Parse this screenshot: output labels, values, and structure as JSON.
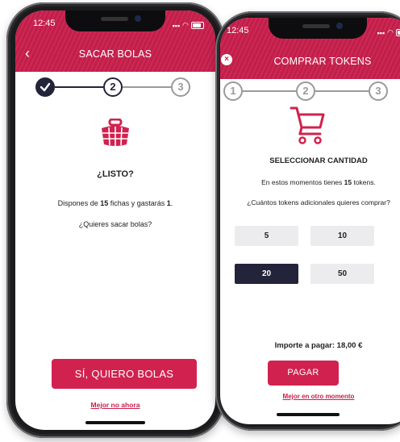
{
  "left": {
    "status": {
      "time": "12:45"
    },
    "header": {
      "title": "SACAR BOLAS"
    },
    "steps": {
      "s2": "2",
      "s3": "3"
    },
    "heading": "¿LISTO?",
    "message": {
      "pre": "Dispones de ",
      "fichas": "15",
      "mid": " fichas y gastarás ",
      "cost": "1",
      "post": "."
    },
    "question": "¿Quieres sacar bolas?",
    "primary_button": "SÍ, QUIERO BOLAS",
    "secondary_link": "Mejor no ahora"
  },
  "right": {
    "status": {
      "time": "12:45"
    },
    "header": {
      "title": "COMPRAR TOKENS"
    },
    "steps": {
      "s1": "1",
      "s2": "2",
      "s3": "3"
    },
    "heading": "SELECCIONAR CANTIDAD",
    "message": {
      "pre": "En estos momentos tienes ",
      "tokens": "15",
      "post": " tokens."
    },
    "question": "¿Cuántos tokens adicionales quieres comprar?",
    "options": [
      "5",
      "10",
      "20",
      "50"
    ],
    "selected": "20",
    "total_label": "Importe a pagar: 18,00 €",
    "primary_button": "PAGAR",
    "secondary_link": "Mejor en otro momento"
  },
  "colors": {
    "accent": "#c81f4c",
    "dark": "#23233a"
  }
}
